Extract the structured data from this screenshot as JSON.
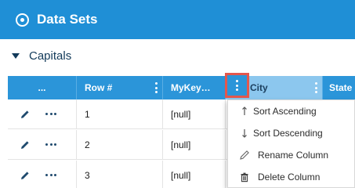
{
  "header": {
    "title": "Data Sets",
    "icon": "target-icon"
  },
  "section": {
    "label": "Capitals",
    "icon": "caret-down-icon"
  },
  "table": {
    "columns": [
      {
        "label": "...",
        "icon": "more-icon"
      },
      {
        "label": "Row #"
      },
      {
        "label": "MyKey…"
      },
      {
        "label": "City"
      },
      {
        "label": "State"
      }
    ],
    "rows": [
      {
        "row_num": "1",
        "key": "[null]"
      },
      {
        "row_num": "2",
        "key": "[null]"
      },
      {
        "row_num": "3",
        "key": "[null]"
      }
    ]
  },
  "column_menu": {
    "items": [
      {
        "label": "Sort Ascending",
        "icon": "arrow-up-icon"
      },
      {
        "label": "Sort Descending",
        "icon": "arrow-down-icon"
      },
      {
        "label": "Rename Column",
        "icon": "pencil-icon"
      },
      {
        "label": "Delete Column",
        "icon": "trash-icon"
      }
    ]
  },
  "colors": {
    "header_bg": "#1f8fd6",
    "table_header_bg": "#2b95d9",
    "selected_column_bg": "#8cc7ee",
    "highlight_border": "#e4574d",
    "section_text": "#123a5a"
  }
}
